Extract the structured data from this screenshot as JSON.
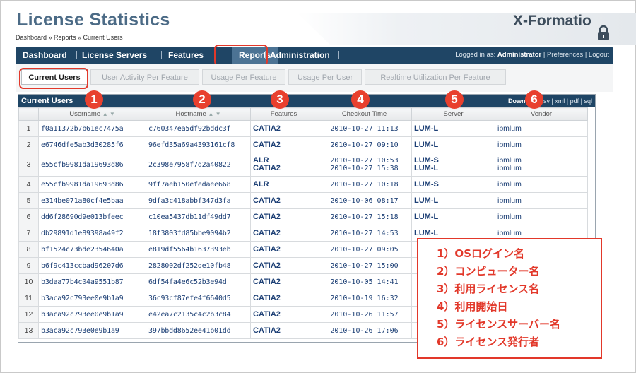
{
  "header": {
    "title": "License Statistics",
    "breadcrumb": "Dashboard  »  Reports  »  Current Users",
    "brand": "X-Formatio"
  },
  "nav": {
    "items": [
      "Dashboard",
      "License Servers",
      "Features",
      "Reports",
      "Administration"
    ],
    "active": "Reports",
    "login_prefix": "Logged in as:",
    "login_user": "Administrator",
    "login_links": "| Preferences | Logout"
  },
  "tabs": [
    "Current Users",
    "User Activity Per Feature",
    "Usage Per Feature",
    "Usage Per User",
    "Realtime Utilization Per Feature"
  ],
  "panel": {
    "title": "Current Users",
    "download_label": "Download",
    "download_links": "csv | xml | pdf | sql"
  },
  "table": {
    "columns": [
      "",
      "Username",
      "Hostname",
      "Features",
      "Checkout Time",
      "Server",
      "Vendor"
    ],
    "sort_marks": "▲ ▼",
    "rows": [
      {
        "n": "1",
        "user": "f0a11372b7b61ec7475a",
        "host": "c760347ea5df92bddc3f",
        "features": [
          "CATIA2"
        ],
        "times": [
          "2010-10-27 11:13"
        ],
        "servers": [
          "LUM-L"
        ],
        "vendors": [
          "ibmlum"
        ]
      },
      {
        "n": "2",
        "user": "e6746dfe5ab3d30285f6",
        "host": "96efd35a69a4393161cf8",
        "features": [
          "CATIA2"
        ],
        "times": [
          "2010-10-27 09:10"
        ],
        "servers": [
          "LUM-L"
        ],
        "vendors": [
          "ibmlum"
        ]
      },
      {
        "n": "3",
        "user": "e55cfb9981da19693d86",
        "host": "2c398e7958f7d2a40822",
        "features": [
          "ALR",
          "CATIA2"
        ],
        "times": [
          "2010-10-27 10:53",
          "2010-10-27 15:38"
        ],
        "servers": [
          "LUM-S",
          "LUM-L"
        ],
        "vendors": [
          "ibmlum",
          "ibmlum"
        ]
      },
      {
        "n": "4",
        "user": "e55cfb9981da19693d86",
        "host": "9ff7aeb150efedaee668",
        "features": [
          "ALR"
        ],
        "times": [
          "2010-10-27 10:18"
        ],
        "servers": [
          "LUM-S"
        ],
        "vendors": [
          "ibmlum"
        ]
      },
      {
        "n": "5",
        "user": "e314be071a80cf4e5baa",
        "host": "9dfa3c418abbf347d3fa",
        "features": [
          "CATIA2"
        ],
        "times": [
          "2010-10-06 08:17"
        ],
        "servers": [
          "LUM-L"
        ],
        "vendors": [
          "ibmlum"
        ]
      },
      {
        "n": "6",
        "user": "dd6f28690d9e013bfeec",
        "host": "c10ea5437db11df49dd7",
        "features": [
          "CATIA2"
        ],
        "times": [
          "2010-10-27 15:18"
        ],
        "servers": [
          "LUM-L"
        ],
        "vendors": [
          "ibmlum"
        ]
      },
      {
        "n": "7",
        "user": "db29891d1e89398a49f2",
        "host": "18f3803fd85bbe9094b2",
        "features": [
          "CATIA2"
        ],
        "times": [
          "2010-10-27 14:53"
        ],
        "servers": [
          "LUM-L"
        ],
        "vendors": [
          "ibmlum"
        ]
      },
      {
        "n": "8",
        "user": "bf1524c73bde2354640a",
        "host": "e819df5564b1637393eb",
        "features": [
          "CATIA2"
        ],
        "times": [
          "2010-10-27 09:05"
        ],
        "servers": [
          ""
        ],
        "vendors": [
          ""
        ]
      },
      {
        "n": "9",
        "user": "b6f9c413ccbad96207d6",
        "host": "2828002df252de10fb48",
        "features": [
          "CATIA2"
        ],
        "times": [
          "2010-10-27 15:00"
        ],
        "servers": [
          ""
        ],
        "vendors": [
          ""
        ]
      },
      {
        "n": "10",
        "user": "b3daa77b4c04a9551b87",
        "host": "6df54fa4e6c52b3e94d",
        "features": [
          "CATIA2"
        ],
        "times": [
          "2010-10-05 14:41"
        ],
        "servers": [
          ""
        ],
        "vendors": [
          ""
        ]
      },
      {
        "n": "11",
        "user": "b3aca92c793ee0e9b1a9",
        "host": "36c93cf87efe4f6640d5",
        "features": [
          "CATIA2"
        ],
        "times": [
          "2010-10-19 16:32"
        ],
        "servers": [
          ""
        ],
        "vendors": [
          ""
        ]
      },
      {
        "n": "12",
        "user": "b3aca92c793ee0e9b1a9",
        "host": "e42ea7c2135c4c2b3c84",
        "features": [
          "CATIA2"
        ],
        "times": [
          "2010-10-26 11:57"
        ],
        "servers": [
          ""
        ],
        "vendors": [
          ""
        ]
      },
      {
        "n": "13",
        "user": "b3aca92c793e0e9b1a9",
        "host": "397bbdd8652ee41b01dd",
        "features": [
          "CATIA2"
        ],
        "times": [
          "2010-10-26 17:06"
        ],
        "servers": [
          ""
        ],
        "vendors": [
          ""
        ]
      }
    ]
  },
  "markers": [
    "1",
    "2",
    "3",
    "4",
    "5",
    "6"
  ],
  "legend": [
    "1）OSログイン名",
    "2）コンピューター名",
    "3）利用ライセンス名",
    "4）利用開始日",
    "5）ライセンスサーバー名",
    "6）ライセンス発行者"
  ],
  "colors": {
    "nav": "#1f4565",
    "accent": "#e2382a",
    "title": "#4c6b86"
  }
}
